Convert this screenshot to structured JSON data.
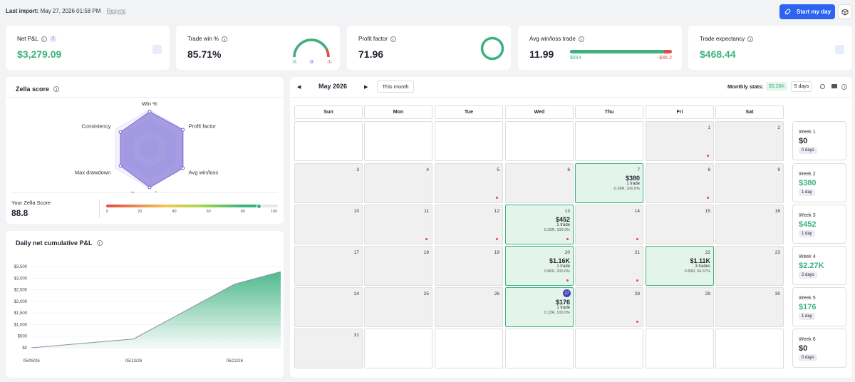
{
  "top": {
    "import_label": "Last import:",
    "import_time": "May 27, 2026 01:58 PM",
    "resync": "Resync",
    "start_button": "Start my day"
  },
  "metrics": {
    "net_pnl": {
      "label": "Net P&L",
      "badge": "7",
      "value": "$3,279.09"
    },
    "trade_win": {
      "label": "Trade win %",
      "value": "85.71%",
      "gauge": {
        "win": "6",
        "be": "0",
        "loss": "1",
        "fraction": 0.857
      }
    },
    "profit_factor": {
      "label": "Profit factor",
      "value": "71.96"
    },
    "avg_win_loss": {
      "label": "Avg win/loss trade",
      "value": "11.99",
      "win": "$554",
      "loss": "-$46.2",
      "win_fraction": 0.923
    },
    "expectancy": {
      "label": "Trade expectancy",
      "value": "$468.44"
    }
  },
  "zella": {
    "title": "Zella score",
    "axes": [
      "Win %",
      "Profit factor",
      "Avg win/loss",
      "Recovery factor",
      "Max drawdown",
      "Consistency"
    ],
    "values": [
      0.95,
      0.98,
      0.98,
      0.98,
      0.86,
      0.86
    ],
    "score_label": "Your Zella Score",
    "score": "88.8",
    "score_value": 88.8,
    "scale": [
      "0",
      "20",
      "40",
      "60",
      "80",
      "100"
    ]
  },
  "cumulative": {
    "title": "Daily net cumulative P&L",
    "chart_data": {
      "type": "area",
      "x": [
        "05/08/26",
        "05/13/26",
        "05/22/26",
        "05/27/26"
      ],
      "y": [
        0,
        380,
        2740,
        3279
      ],
      "xticks": [
        "05/08/26",
        "05/13/26",
        "05/22/26"
      ],
      "yticks": [
        "$0",
        "$500",
        "$1,000",
        "$1,500",
        "$2,000",
        "$2,500",
        "$3,000",
        "$3,500"
      ],
      "ylim": [
        0,
        3500
      ]
    }
  },
  "calendar": {
    "month": "May 2026",
    "this_month": "This month",
    "monthly_stats_label": "Monthly stats:",
    "monthly_stats_value": "$3.28K",
    "five_days": "5 days",
    "days": [
      "Sun",
      "Mon",
      "Tue",
      "Wed",
      "Thu",
      "Fri",
      "Sat"
    ],
    "cells": [
      {
        "d": ""
      },
      {
        "d": ""
      },
      {
        "d": ""
      },
      {
        "d": ""
      },
      {
        "d": ""
      },
      {
        "d": "1",
        "dot": true
      },
      {
        "d": "2"
      },
      {
        "d": "3"
      },
      {
        "d": "4"
      },
      {
        "d": "5",
        "dot": true
      },
      {
        "d": "6"
      },
      {
        "d": "7",
        "win": true,
        "val": "$380",
        "trades": "1 trade",
        "stat": "0.28R, 100.0%"
      },
      {
        "d": "8",
        "dot": true
      },
      {
        "d": "9"
      },
      {
        "d": "10"
      },
      {
        "d": "11",
        "dot": true
      },
      {
        "d": "12",
        "dot": true
      },
      {
        "d": "13",
        "win": true,
        "val": "$452",
        "trades": "1 trade",
        "stat": "0.33R, 100.0%",
        "dot": true
      },
      {
        "d": "14",
        "dot": true
      },
      {
        "d": "15"
      },
      {
        "d": "16"
      },
      {
        "d": "17"
      },
      {
        "d": "18"
      },
      {
        "d": "19"
      },
      {
        "d": "20",
        "win": true,
        "val": "$1.16K",
        "trades": "1 trade",
        "stat": "0.86R, 100.0%",
        "dot": true
      },
      {
        "d": "21",
        "dot": true
      },
      {
        "d": "22",
        "win": true,
        "val": "$1.11K",
        "trades": "3 trades",
        "stat": "0.83R, 66.67%"
      },
      {
        "d": "23"
      },
      {
        "d": "24"
      },
      {
        "d": "25"
      },
      {
        "d": "26"
      },
      {
        "d": "27",
        "today": true,
        "win": true,
        "val": "$176",
        "trades": "1 trade",
        "stat": "0.13R, 100.0%"
      },
      {
        "d": "28",
        "dot": true
      },
      {
        "d": "29"
      },
      {
        "d": "30"
      },
      {
        "d": "31"
      },
      {
        "d": "",
        "empty": true
      },
      {
        "d": "",
        "empty": true
      },
      {
        "d": "",
        "empty": true
      },
      {
        "d": "",
        "empty": true
      },
      {
        "d": "",
        "empty": true
      },
      {
        "d": "",
        "empty": true
      }
    ],
    "weeks": [
      {
        "label": "Week 1",
        "value": "$0",
        "days": "0 days",
        "pos": false
      },
      {
        "label": "Week 2",
        "value": "$380",
        "days": "1 day",
        "pos": true
      },
      {
        "label": "Week 3",
        "value": "$452",
        "days": "1 day",
        "pos": true
      },
      {
        "label": "Week 4",
        "value": "$2.27K",
        "days": "2 days",
        "pos": true
      },
      {
        "label": "Week 5",
        "value": "$176",
        "days": "1 day",
        "pos": true
      },
      {
        "label": "Week 6",
        "value": "$0",
        "days": "0 days",
        "pos": false
      }
    ]
  },
  "colors": {
    "green": "#3bb27f",
    "red": "#e24b4b",
    "accent": "#2c63f0",
    "purple": "#7b6ed6"
  }
}
